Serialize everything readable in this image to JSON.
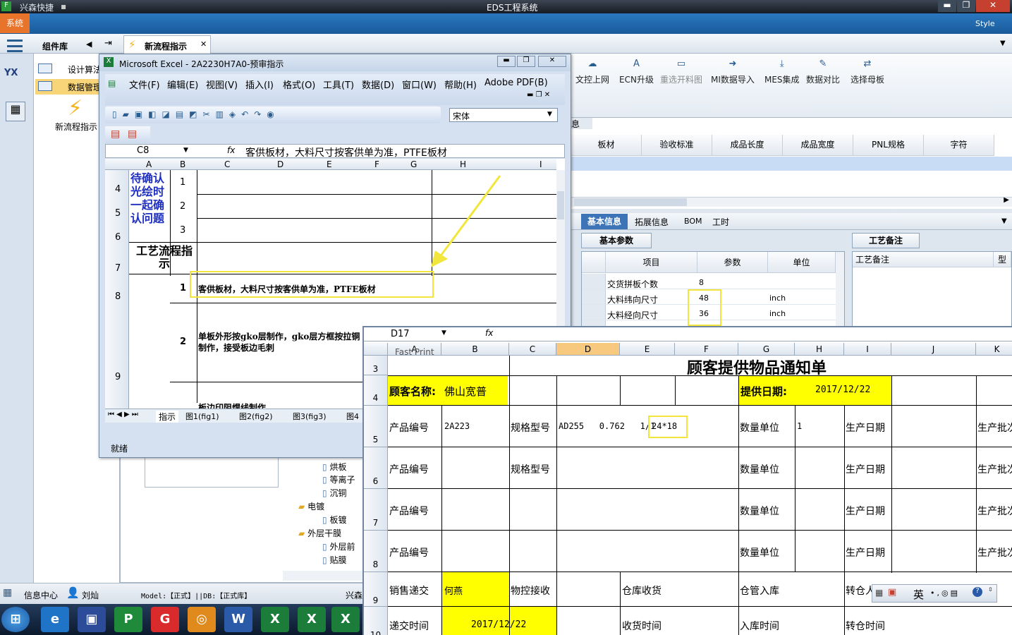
{
  "app": {
    "title": "EDS工程系统",
    "app_name": "兴森快捷",
    "system_menu": "系统",
    "style_label": "Style",
    "tabs": {
      "component_lib": "组件库",
      "new_flow": "新流程指示"
    },
    "left_items": [
      "设计算法",
      "数据管理"
    ],
    "left_panel_item": "新流程指示",
    "logo": "YX"
  },
  "ribbon": [
    "文控上网",
    "ECN升级",
    "重选开料图",
    "MI数据导入",
    "MES集成",
    "数据对比",
    "选择母板"
  ],
  "grid_headers": [
    "板材",
    "验收标准",
    "成品长度",
    "成品宽度",
    "PNL规格",
    "字符"
  ],
  "grid_prefix": "息",
  "info_tabs": [
    "基本信息",
    "拓展信息",
    "BOM",
    "工时"
  ],
  "basic_params": {
    "title": "基本参数",
    "headers": [
      "项目",
      "参数",
      "单位"
    ],
    "rows": [
      {
        "item": "交货拼板个数",
        "value": "8",
        "unit": ""
      },
      {
        "item": "大料纬向尺寸",
        "value": "48",
        "unit": "inch"
      },
      {
        "item": "大料经向尺寸",
        "value": "36",
        "unit": "inch"
      }
    ]
  },
  "process_note": {
    "title": "工艺备注",
    "label": "工艺备注",
    "col": "型"
  },
  "tree": [
    "烘板",
    "等离子",
    "沉铜",
    "电镀",
    "板镀",
    "外层干膜",
    "外层前",
    "贴膜"
  ],
  "status": {
    "info_center": "信息中心",
    "user": "刘灿",
    "model": "Model:【正式】||DB:【正式库】",
    "right": "兴森"
  },
  "excel1": {
    "title": "Microsoft Excel - 2A2230H7A0-预审指示",
    "menus": [
      "文件(F)",
      "编辑(E)",
      "视图(V)",
      "插入(I)",
      "格式(O)",
      "工具(T)",
      "数据(D)",
      "窗口(W)",
      "帮助(H)",
      "Adobe PDF(B)"
    ],
    "font": "宋体",
    "cell_ref": "C8",
    "fx": "fx",
    "formula": "客供板材，大料尺寸按客供单为准，PTFE板材",
    "columns": [
      "A",
      "B",
      "C",
      "D",
      "E",
      "F",
      "G",
      "H",
      "I"
    ],
    "rows": [
      "4",
      "5",
      "6",
      "7",
      "8",
      "9"
    ],
    "confirm_text": "待确认光绘时一起确认问题",
    "nums": [
      "1",
      "2",
      "3"
    ],
    "flow_label": "工艺流程指示",
    "row8_num": "1",
    "row8_text": "客供板材，大料尺寸按客供单为准，PTFE板材",
    "row9_num": "2",
    "row9_text": "单板外形按gko层制作，gko层方框按拉铜制作，接受板边毛刺",
    "row10_text": "板边印阻焊线制作",
    "sheets": [
      "指示",
      "图1(fig1)",
      "图2(fig2)",
      "图3(fig3)",
      "图4"
    ],
    "status": "就绪"
  },
  "excel2": {
    "cell_ref": "D17",
    "fx": "fx",
    "columns": [
      "A",
      "B",
      "C",
      "D",
      "E",
      "F",
      "G",
      "H",
      "I",
      "J",
      "K"
    ],
    "rows": [
      "3",
      "4",
      "5",
      "6",
      "7",
      "8",
      "9",
      "10"
    ],
    "clipped_top": "Fast Print",
    "title": "顾客提供物品通知单",
    "customer_label": "顾客名称:",
    "customer": "佛山宽普",
    "date_label": "提供日期:",
    "date": "2017/12/22",
    "product_no": "产品编号",
    "spec": "规格型号",
    "qty": "数量单位",
    "prod_date": "生产日期",
    "batch": "生产批次",
    "p1_no": "2A223",
    "p1_spec": "AD255   0.762   1/1",
    "p1_size": "24*18",
    "p1_qty": "1",
    "sales_submit": "销售递交",
    "sales_person": "何燕",
    "material_receive": "物控接收",
    "warehouse_receive": "仓库收货",
    "warehouse_in": "仓管入库",
    "transfer": "转仓人",
    "submit_time": "递交时间",
    "submit_date": "2017/12/22",
    "receive_time": "收货时间",
    "in_time": "入库时间",
    "transfer_time": "转仓时间"
  },
  "ime": "英"
}
